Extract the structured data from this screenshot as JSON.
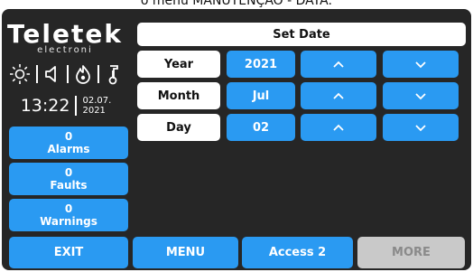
{
  "caption": "o menu MANUTENÇÃO - DATA:",
  "brand": {
    "name": "Teletek",
    "sub": "electroni"
  },
  "status_icons": [
    "sun-icon",
    "speaker-icon",
    "flame-icon",
    "thermometer-icon"
  ],
  "clock": {
    "time": "13:22",
    "date_day": "02.07.",
    "date_year": "2021"
  },
  "status_buttons": [
    {
      "count": "0",
      "label": "Alarms"
    },
    {
      "count": "0",
      "label": "Faults"
    },
    {
      "count": "0",
      "label": "Warnings"
    }
  ],
  "panel": {
    "title": "Set Date",
    "rows": [
      {
        "label": "Year",
        "value": "2021"
      },
      {
        "label": "Month",
        "value": "Jul"
      },
      {
        "label": "Day",
        "value": "02"
      }
    ]
  },
  "bottom": {
    "exit": "EXIT",
    "menu": "MENU",
    "access": "Access 2",
    "more": "MORE"
  },
  "colors": {
    "background": "#262626",
    "accent": "#2a9af2",
    "panel": "#ffffff",
    "disabled": "#c9c9c9"
  }
}
